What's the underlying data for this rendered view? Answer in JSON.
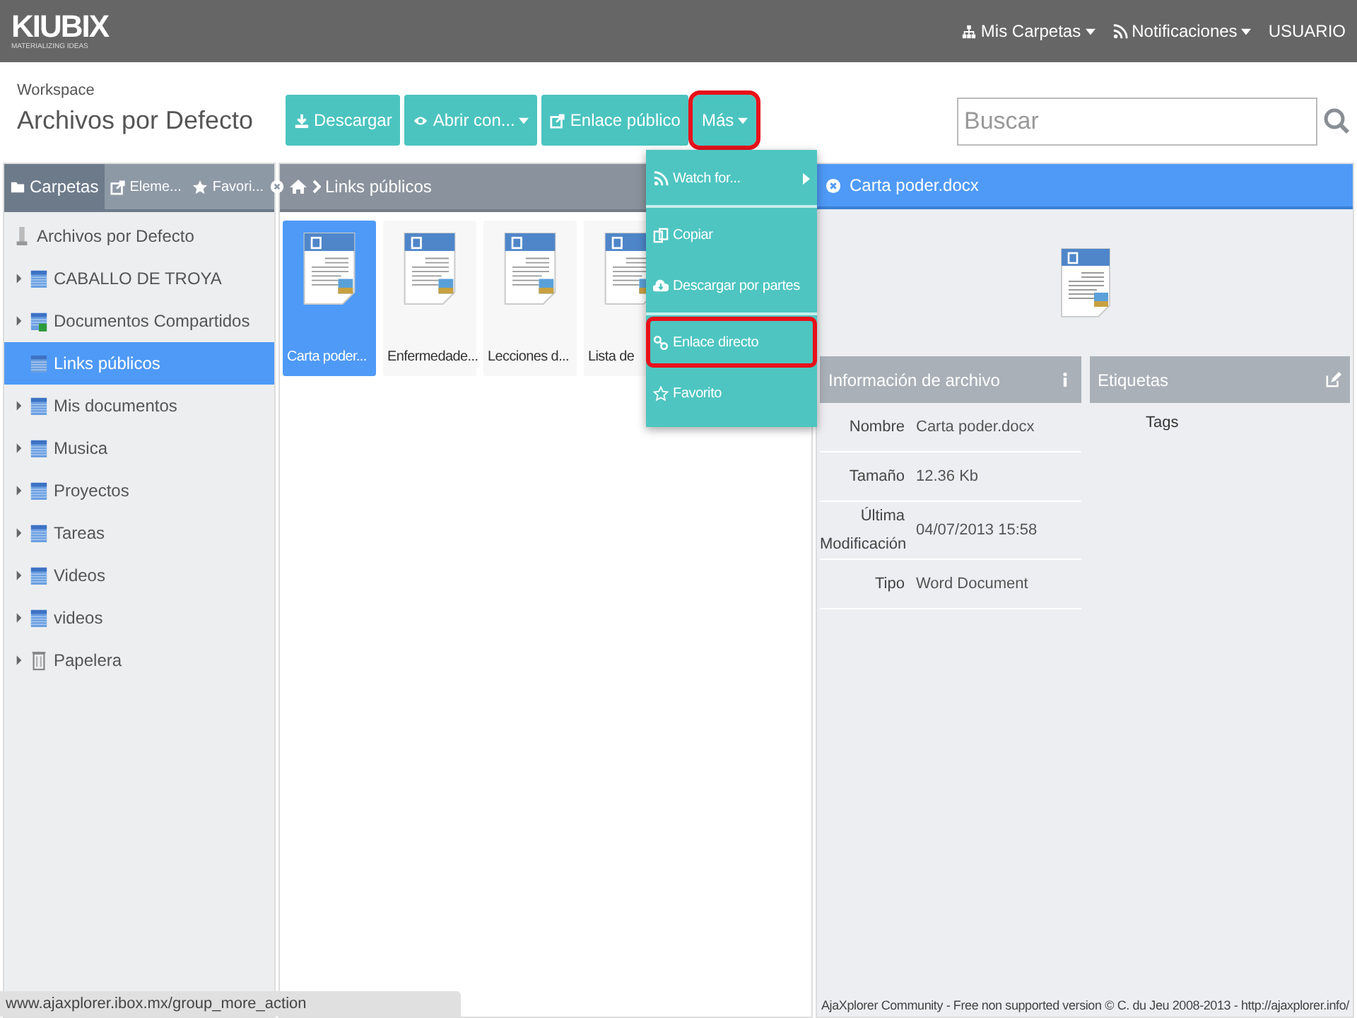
{
  "app": {
    "logo": "KIUBIX",
    "tagline": "MATERIALIZING IDEAS"
  },
  "top_nav": [
    {
      "label": "Mis Carpetas",
      "dropdown": true
    },
    {
      "label": "Notificaciones",
      "dropdown": true
    },
    {
      "label": "USUARIO",
      "dropdown": false
    }
  ],
  "workspace": {
    "label": "Workspace",
    "title": "Archivos por Defecto"
  },
  "toolbar": [
    {
      "label": "Descargar",
      "dropdown": false,
      "highlighted": false
    },
    {
      "label": "Abrir con...",
      "dropdown": true,
      "highlighted": false
    },
    {
      "label": "Enlace público",
      "dropdown": false,
      "highlighted": false
    },
    {
      "label": "Más",
      "dropdown": true,
      "highlighted": true
    }
  ],
  "search": {
    "placeholder": "Buscar"
  },
  "more_menu": [
    {
      "label": "Watch for...",
      "submenu": true,
      "divider_after": true,
      "highlighted": false
    },
    {
      "label": "Copiar",
      "submenu": false,
      "divider_after": false,
      "highlighted": false
    },
    {
      "label": "Descargar por partes",
      "submenu": false,
      "divider_after": true,
      "highlighted": false
    },
    {
      "label": "Enlace directo",
      "submenu": false,
      "divider_after": false,
      "highlighted": true
    },
    {
      "label": "Favorito",
      "submenu": false,
      "divider_after": false,
      "highlighted": false
    }
  ],
  "left_tabs": [
    {
      "label": "Carpetas",
      "selected": true
    },
    {
      "label": "Eleme...",
      "selected": false
    },
    {
      "label": "Favori...",
      "selected": false
    }
  ],
  "tree": [
    {
      "kind": "root",
      "label": "Archivos por Defecto",
      "selected": false,
      "children": [
        {
          "kind": "folder",
          "label": "CABALLO DE TROYA",
          "expandable": true,
          "selected": false
        },
        {
          "kind": "shared",
          "label": "Documentos Compartidos",
          "expandable": true,
          "selected": false
        },
        {
          "kind": "folder",
          "label": "Links públicos",
          "expandable": false,
          "selected": true
        },
        {
          "kind": "folder",
          "label": "Mis documentos",
          "expandable": true,
          "selected": false
        },
        {
          "kind": "folder",
          "label": "Musica",
          "expandable": true,
          "selected": false
        },
        {
          "kind": "folder",
          "label": "Proyectos",
          "expandable": true,
          "selected": false
        },
        {
          "kind": "folder",
          "label": "Tareas",
          "expandable": true,
          "selected": false
        },
        {
          "kind": "folder",
          "label": "Videos",
          "expandable": true,
          "selected": false
        },
        {
          "kind": "folder",
          "label": "videos",
          "expandable": true,
          "selected": false
        },
        {
          "kind": "trash",
          "label": "Papelera",
          "expandable": true,
          "selected": false
        }
      ]
    }
  ],
  "breadcrumb": "Links públicos",
  "files": [
    {
      "name": "Carta poder...",
      "selected": true
    },
    {
      "name": "Enfermedade...",
      "selected": false
    },
    {
      "name": "Lecciones d...",
      "selected": false
    },
    {
      "name": "Lista de",
      "selected": false
    }
  ],
  "details": {
    "title": "Carta poder.docx",
    "info_title": "Información de archivo",
    "tags_title": "Etiquetas",
    "tags": "Tags",
    "fields": [
      {
        "label": "Nombre",
        "value": "Carta poder.docx"
      },
      {
        "label": "Tamaño",
        "value": "12.36 Kb"
      },
      {
        "label": "Última Modificación",
        "value": "04/07/2013 15:58"
      },
      {
        "label": "Tipo",
        "value": "Word Document"
      }
    ]
  },
  "status_url": "www.ajaxplorer.ibox.mx/group_more_action",
  "footer": "AjaXplorer Community - Free non supported version © C. du Jeu 2008-2013 - http://ajaxplorer.info/"
}
